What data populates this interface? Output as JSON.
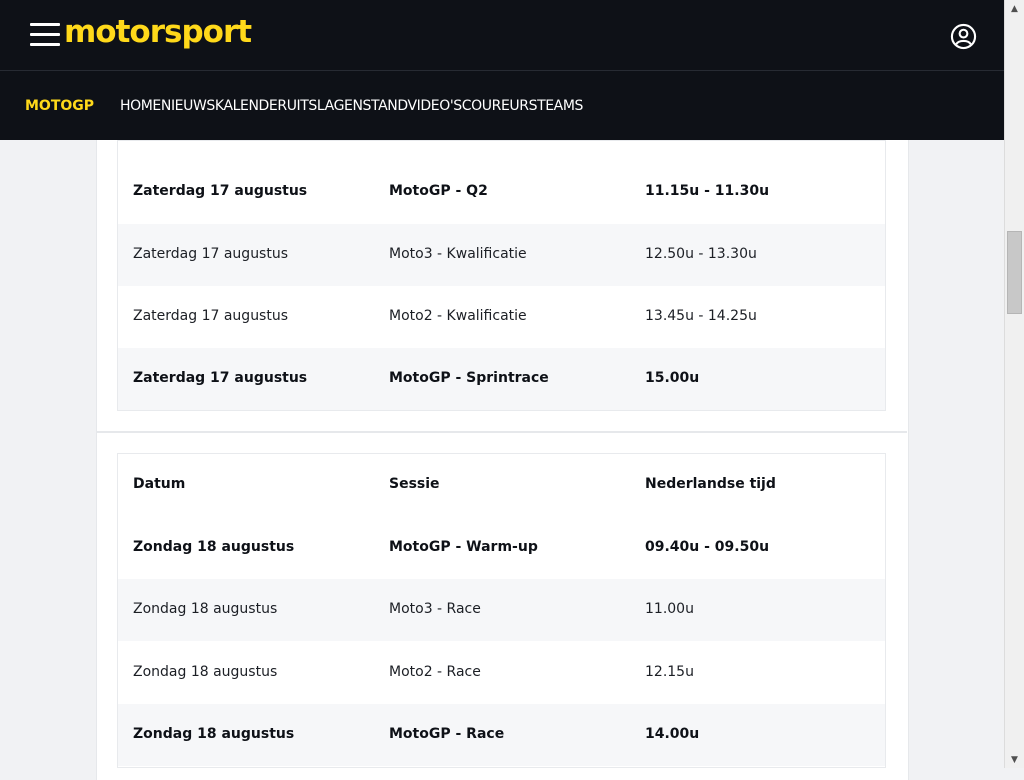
{
  "header": {
    "logo": "motorsport",
    "menu_icon": "hamburger-menu-icon",
    "account_icon": "user-account-icon"
  },
  "nav": {
    "brand": "MOTOGP",
    "items": [
      "HOME",
      "NIEUWS",
      "KALENDER",
      "UITSLAGEN",
      "STAND",
      "VIDEO'S",
      "COUREURS",
      "TEAMS"
    ]
  },
  "saturday_table": {
    "rows": [
      {
        "date": "Zaterdag 17 augustus",
        "session": "MotoGP - Q2",
        "time": "11.15u - 11.30u",
        "highlight": true
      },
      {
        "date": "Zaterdag 17 augustus",
        "session": "Moto3 - Kwalificatie",
        "time": "12.50u - 13.30u",
        "highlight": false
      },
      {
        "date": "Zaterdag 17 augustus",
        "session": "Moto2 - Kwalificatie",
        "time": "13.45u - 14.25u",
        "highlight": false
      },
      {
        "date": "Zaterdag 17 augustus",
        "session": "MotoGP - Sprintrace",
        "time": "15.00u",
        "highlight": true
      }
    ]
  },
  "sunday_table": {
    "headers": {
      "date": "Datum",
      "session": "Sessie",
      "time": "Nederlandse tijd"
    },
    "rows": [
      {
        "date": "Zondag 18 augustus",
        "session": "MotoGP - Warm-up",
        "time": "09.40u - 09.50u",
        "highlight": true
      },
      {
        "date": "Zondag 18 augustus",
        "session": "Moto3 - Race",
        "time": "11.00u",
        "highlight": false
      },
      {
        "date": "Zondag 18 augustus",
        "session": "Moto2 - Race",
        "time": "12.15u",
        "highlight": false
      },
      {
        "date": "Zondag 18 augustus",
        "session": "MotoGP - Race",
        "time": "14.00u",
        "highlight": true
      }
    ]
  },
  "colors": {
    "brand_yellow": "#ffd91a",
    "header_bg": "#0e1117"
  }
}
